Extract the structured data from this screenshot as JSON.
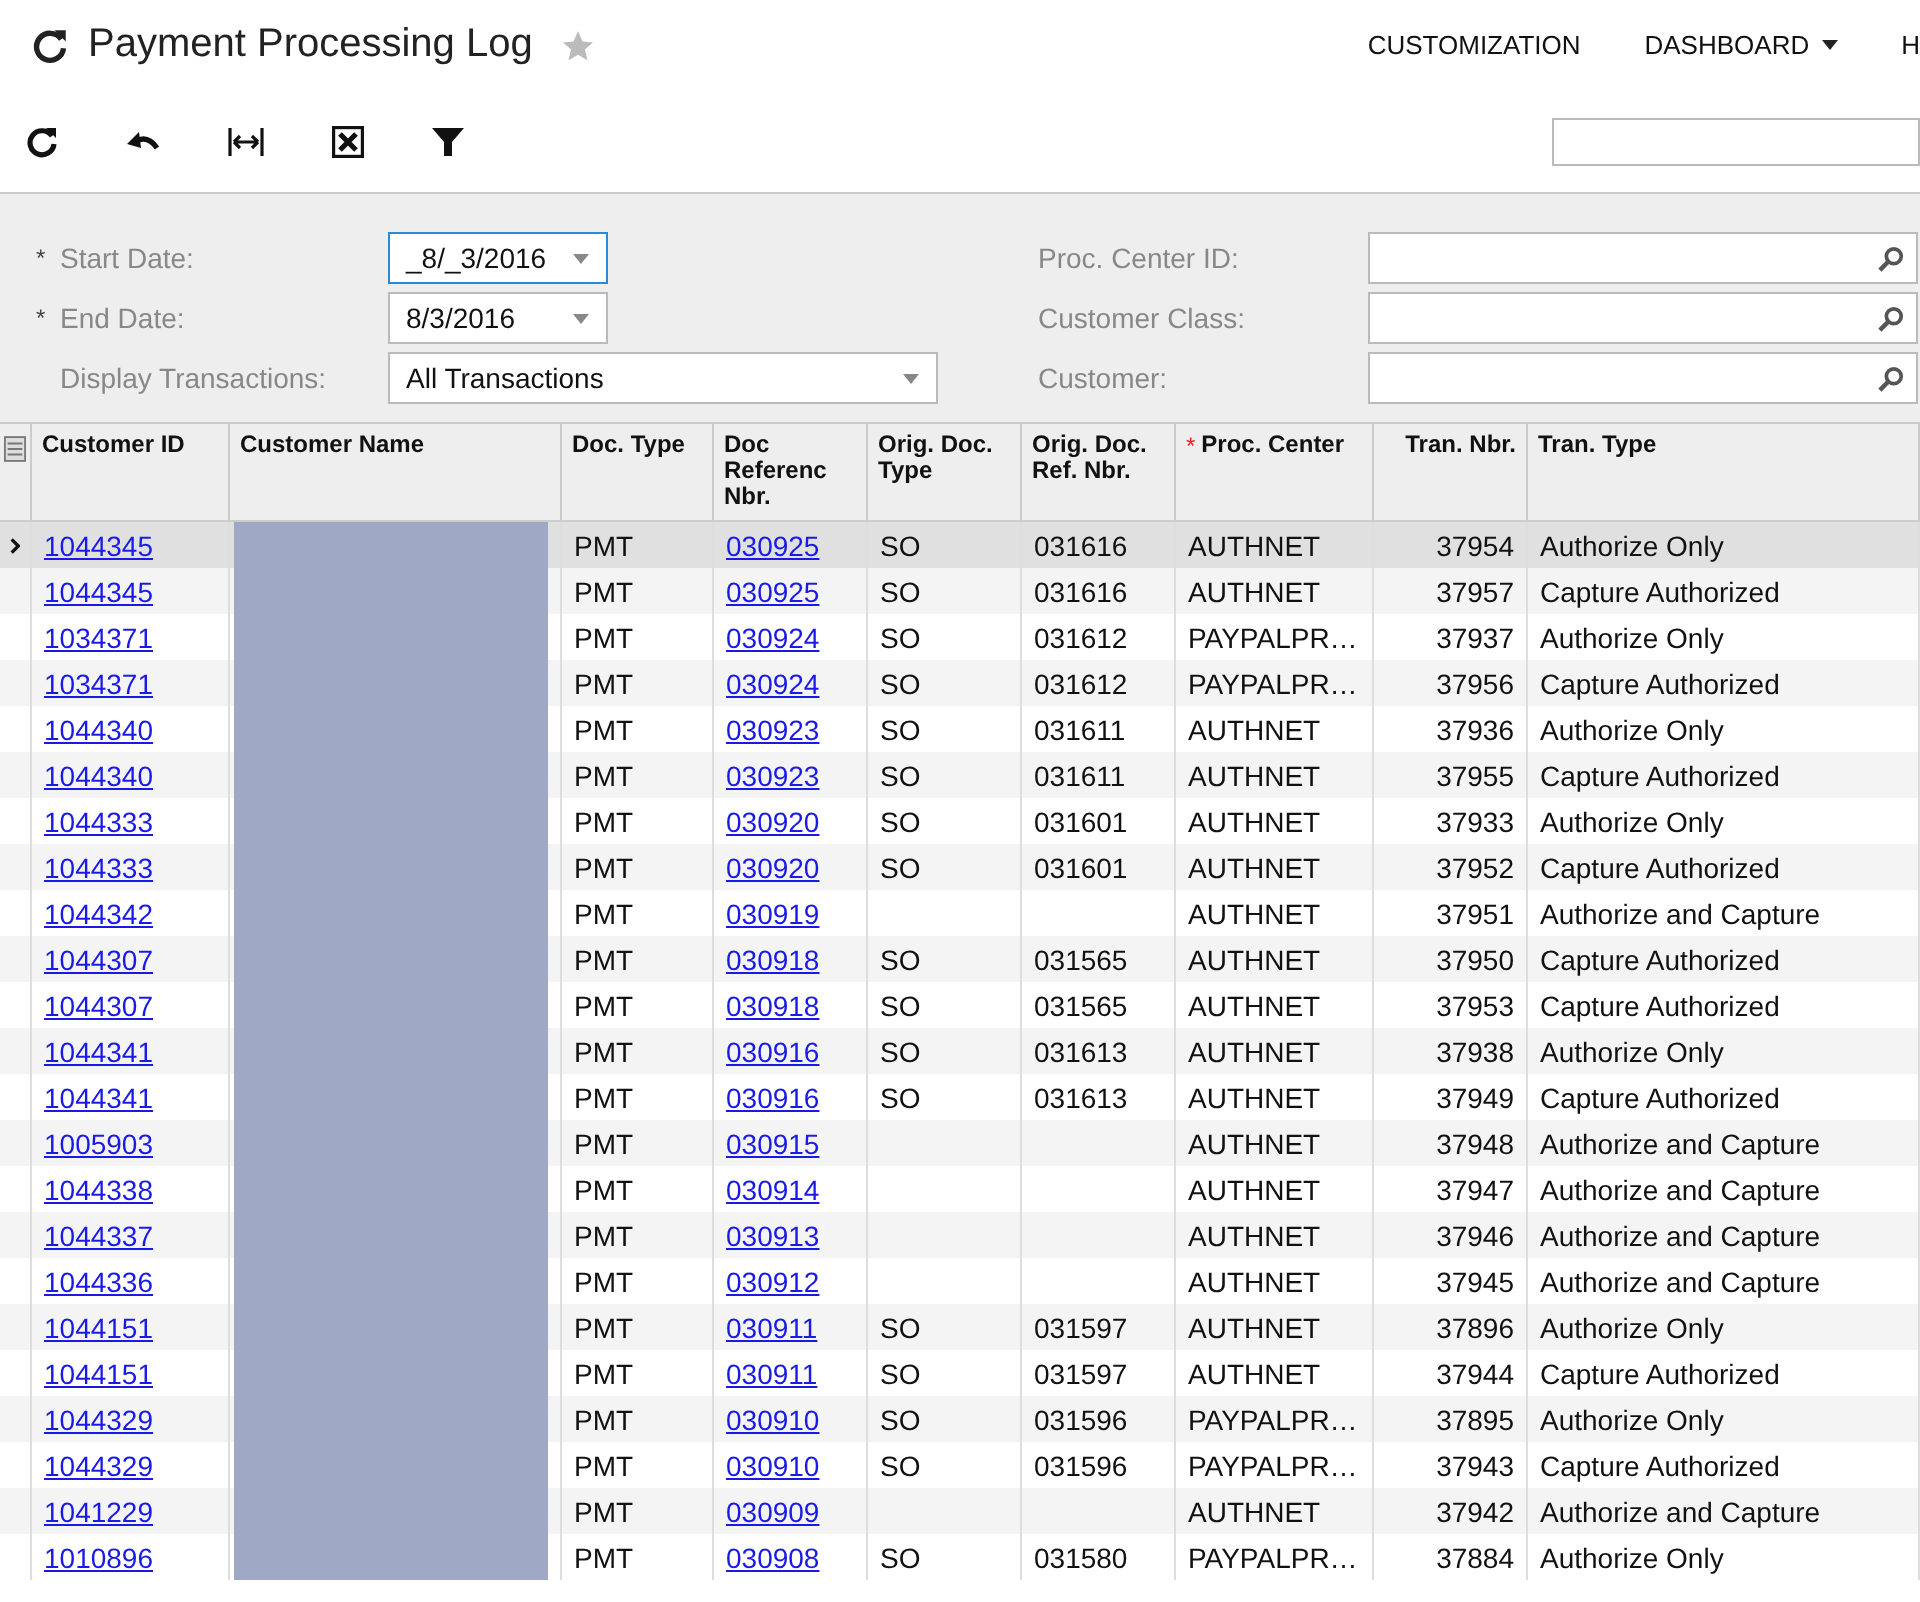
{
  "title": "Payment Processing Log",
  "nav": [
    {
      "label": "CUSTOMIZATION",
      "dropdown": false
    },
    {
      "label": "DASHBOARD",
      "dropdown": true
    },
    {
      "label": "H",
      "dropdown": false
    }
  ],
  "filters_left": [
    {
      "required_mark": "*",
      "label": "Start Date:",
      "value": "_8/_3/2016",
      "focused": true,
      "kind": "date"
    },
    {
      "required_mark": "*",
      "label": "End Date:",
      "value": "8/3/2016",
      "focused": false,
      "kind": "date"
    },
    {
      "label": "Display Transactions:",
      "value": "All Transactions",
      "focused": false,
      "kind": "select"
    }
  ],
  "filters_right": [
    {
      "label": "Proc. Center ID:"
    },
    {
      "label": "Customer Class:"
    },
    {
      "label": "Customer:"
    }
  ],
  "columns": [
    {
      "label": "Customer ID"
    },
    {
      "label": "Customer Name"
    },
    {
      "label": "Doc. Type"
    },
    {
      "label": "Doc Referenc Nbr."
    },
    {
      "label": "Orig. Doc. Type"
    },
    {
      "label": "Orig. Doc. Ref. Nbr."
    },
    {
      "required_mark": "*",
      "label": "Proc. Center"
    },
    {
      "label": "Tran. Nbr."
    },
    {
      "label": "Tran. Type"
    }
  ],
  "rows": [
    {
      "selected": true,
      "customer_id": "1044345",
      "doc_type": "PMT",
      "doc_ref": "030925",
      "orig_type": "SO",
      "orig_ref": "031616",
      "proc_center": "AUTHNET",
      "tran_nbr": "37954",
      "tran_type": "Authorize Only"
    },
    {
      "selected": false,
      "customer_id": "1044345",
      "doc_type": "PMT",
      "doc_ref": "030925",
      "orig_type": "SO",
      "orig_ref": "031616",
      "proc_center": "AUTHNET",
      "tran_nbr": "37957",
      "tran_type": "Capture Authorized"
    },
    {
      "selected": false,
      "customer_id": "1034371",
      "doc_type": "PMT",
      "doc_ref": "030924",
      "orig_type": "SO",
      "orig_ref": "031612",
      "proc_center": "PAYPALPR…",
      "tran_nbr": "37937",
      "tran_type": "Authorize Only"
    },
    {
      "selected": false,
      "customer_id": "1034371",
      "doc_type": "PMT",
      "doc_ref": "030924",
      "orig_type": "SO",
      "orig_ref": "031612",
      "proc_center": "PAYPALPR…",
      "tran_nbr": "37956",
      "tran_type": "Capture Authorized"
    },
    {
      "selected": false,
      "customer_id": "1044340",
      "doc_type": "PMT",
      "doc_ref": "030923",
      "orig_type": "SO",
      "orig_ref": "031611",
      "proc_center": "AUTHNET",
      "tran_nbr": "37936",
      "tran_type": "Authorize Only"
    },
    {
      "selected": false,
      "customer_id": "1044340",
      "doc_type": "PMT",
      "doc_ref": "030923",
      "orig_type": "SO",
      "orig_ref": "031611",
      "proc_center": "AUTHNET",
      "tran_nbr": "37955",
      "tran_type": "Capture Authorized"
    },
    {
      "selected": false,
      "customer_id": "1044333",
      "doc_type": "PMT",
      "doc_ref": "030920",
      "orig_type": "SO",
      "orig_ref": "031601",
      "proc_center": "AUTHNET",
      "tran_nbr": "37933",
      "tran_type": "Authorize Only"
    },
    {
      "selected": false,
      "customer_id": "1044333",
      "doc_type": "PMT",
      "doc_ref": "030920",
      "orig_type": "SO",
      "orig_ref": "031601",
      "proc_center": "AUTHNET",
      "tran_nbr": "37952",
      "tran_type": "Capture Authorized"
    },
    {
      "selected": false,
      "customer_id": "1044342",
      "doc_type": "PMT",
      "doc_ref": "030919",
      "proc_center": "AUTHNET",
      "tran_nbr": "37951",
      "tran_type": "Authorize and Capture"
    },
    {
      "selected": false,
      "customer_id": "1044307",
      "doc_type": "PMT",
      "doc_ref": "030918",
      "orig_type": "SO",
      "orig_ref": "031565",
      "proc_center": "AUTHNET",
      "tran_nbr": "37950",
      "tran_type": "Capture Authorized"
    },
    {
      "selected": false,
      "customer_id": "1044307",
      "doc_type": "PMT",
      "doc_ref": "030918",
      "orig_type": "SO",
      "orig_ref": "031565",
      "proc_center": "AUTHNET",
      "tran_nbr": "37953",
      "tran_type": "Capture Authorized"
    },
    {
      "selected": false,
      "customer_id": "1044341",
      "doc_type": "PMT",
      "doc_ref": "030916",
      "orig_type": "SO",
      "orig_ref": "031613",
      "proc_center": "AUTHNET",
      "tran_nbr": "37938",
      "tran_type": "Authorize Only"
    },
    {
      "selected": false,
      "customer_id": "1044341",
      "doc_type": "PMT",
      "doc_ref": "030916",
      "orig_type": "SO",
      "orig_ref": "031613",
      "proc_center": "AUTHNET",
      "tran_nbr": "37949",
      "tran_type": "Capture Authorized"
    },
    {
      "selected": false,
      "customer_id": "1005903",
      "doc_type": "PMT",
      "doc_ref": "030915",
      "proc_center": "AUTHNET",
      "tran_nbr": "37948",
      "tran_type": "Authorize and Capture"
    },
    {
      "selected": false,
      "customer_id": "1044338",
      "doc_type": "PMT",
      "doc_ref": "030914",
      "proc_center": "AUTHNET",
      "tran_nbr": "37947",
      "tran_type": "Authorize and Capture"
    },
    {
      "selected": false,
      "customer_id": "1044337",
      "doc_type": "PMT",
      "doc_ref": "030913",
      "proc_center": "AUTHNET",
      "tran_nbr": "37946",
      "tran_type": "Authorize and Capture"
    },
    {
      "selected": false,
      "customer_id": "1044336",
      "doc_type": "PMT",
      "doc_ref": "030912",
      "proc_center": "AUTHNET",
      "tran_nbr": "37945",
      "tran_type": "Authorize and Capture"
    },
    {
      "selected": false,
      "customer_id": "1044151",
      "doc_type": "PMT",
      "doc_ref": "030911",
      "orig_type": "SO",
      "orig_ref": "031597",
      "proc_center": "AUTHNET",
      "tran_nbr": "37896",
      "tran_type": "Authorize Only"
    },
    {
      "selected": false,
      "customer_id": "1044151",
      "doc_type": "PMT",
      "doc_ref": "030911",
      "orig_type": "SO",
      "orig_ref": "031597",
      "proc_center": "AUTHNET",
      "tran_nbr": "37944",
      "tran_type": "Capture Authorized"
    },
    {
      "selected": false,
      "customer_id": "1044329",
      "doc_type": "PMT",
      "doc_ref": "030910",
      "orig_type": "SO",
      "orig_ref": "031596",
      "proc_center": "PAYPALPR…",
      "tran_nbr": "37895",
      "tran_type": "Authorize Only"
    },
    {
      "selected": false,
      "customer_id": "1044329",
      "doc_type": "PMT",
      "doc_ref": "030910",
      "orig_type": "SO",
      "orig_ref": "031596",
      "proc_center": "PAYPALPR…",
      "tran_nbr": "37943",
      "tran_type": "Capture Authorized"
    },
    {
      "selected": false,
      "customer_id": "1041229",
      "doc_type": "PMT",
      "doc_ref": "030909",
      "proc_center": "AUTHNET",
      "tran_nbr": "37942",
      "tran_type": "Authorize and Capture"
    },
    {
      "selected": false,
      "customer_id": "1010896",
      "doc_type": "PMT",
      "doc_ref": "030908",
      "orig_type": "SO",
      "orig_ref": "031580",
      "proc_center": "PAYPALPR…",
      "tran_nbr": "37884",
      "tran_type": "Authorize Only"
    }
  ]
}
